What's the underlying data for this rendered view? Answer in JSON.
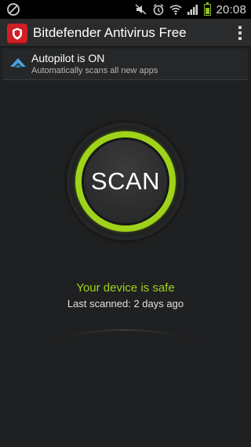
{
  "status_bar": {
    "time": "20:08",
    "icons": [
      "no-entry-icon",
      "mute-icon",
      "alarm-icon",
      "wifi-icon",
      "signal-icon",
      "battery-icon"
    ],
    "battery_level": 0.55,
    "battery_color": "#8fbf2a"
  },
  "app_bar": {
    "title": "Bitdefender Antivirus Free",
    "logo_color": "#cf1f27",
    "menu_icon": "overflow-menu-icon"
  },
  "autopilot": {
    "title": "Autopilot is ON",
    "subtitle": "Automatically scans all new apps",
    "icon": "autopilot-icon",
    "icon_color": "#4aa3df"
  },
  "scan": {
    "label": "SCAN",
    "ring_color": "#9fd31a"
  },
  "status": {
    "safe_text": "Your device is safe",
    "safe_color": "#9fd31a",
    "last_scanned": "Last scanned: 2 days ago"
  }
}
